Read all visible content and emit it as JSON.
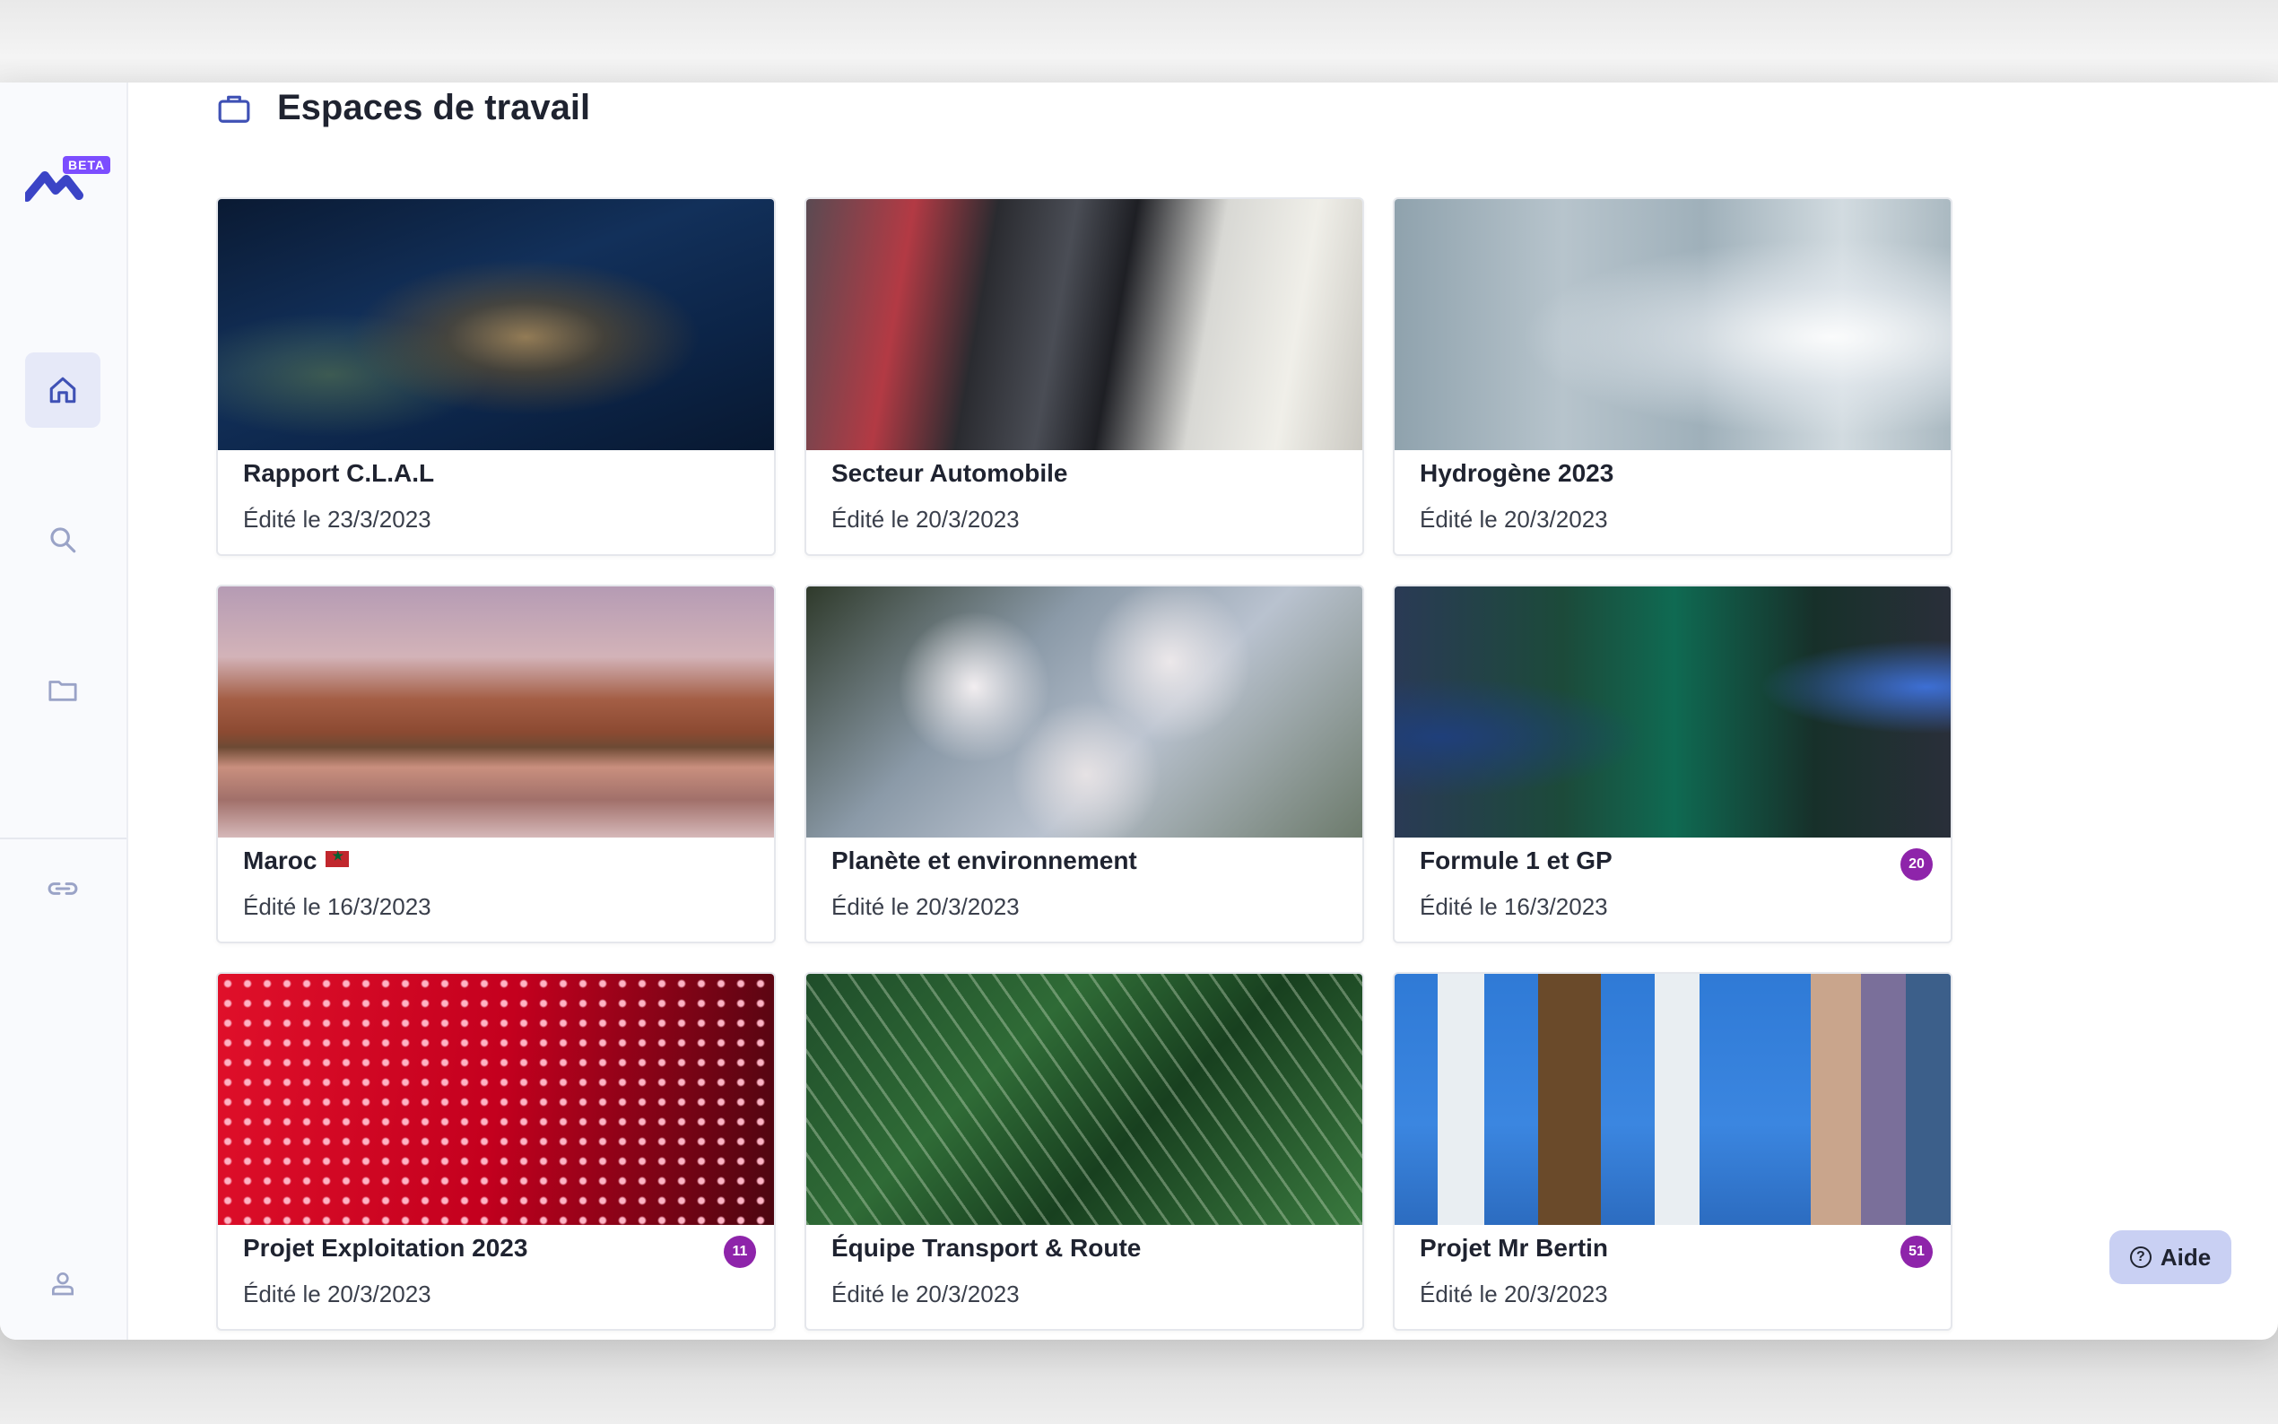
{
  "app": {
    "badge": "BETA",
    "page_title": "Espaces de travail"
  },
  "sidebar": {
    "items": [
      {
        "icon": "home-icon",
        "active": true
      },
      {
        "icon": "search-icon",
        "active": false
      },
      {
        "icon": "folder-icon",
        "active": false
      },
      {
        "icon": "link-icon",
        "active": false
      },
      {
        "icon": "user-icon",
        "active": false
      }
    ]
  },
  "workspaces": [
    {
      "title": "Rapport C.L.A.L",
      "date": "Édité le 23/3/2023",
      "badge": null
    },
    {
      "title": "Secteur Automobile",
      "date": "Édité le 20/3/2023",
      "badge": null
    },
    {
      "title": "Hydrogène 2023",
      "date": "Édité le 20/3/2023",
      "badge": null
    },
    {
      "title": "Maroc",
      "date": "Édité le 16/3/2023",
      "badge": null
    },
    {
      "title": "Planète et environnement",
      "date": "Édité le 20/3/2023",
      "badge": null
    },
    {
      "title": "Formule 1 et GP",
      "date": "Édité le 16/3/2023",
      "badge": "20"
    },
    {
      "title": "Projet Exploitation 2023",
      "date": "Édité le 20/3/2023",
      "badge": "11"
    },
    {
      "title": "Équipe Transport & Route",
      "date": "Édité le 20/3/2023",
      "badge": null
    },
    {
      "title": "Projet Mr Bertin",
      "date": "Édité le 20/3/2023",
      "badge": "51"
    }
  ],
  "help": {
    "label": "Aide"
  },
  "colors": {
    "accent": "#3f51b5",
    "badge": "#8e24aa",
    "help_bg": "#c9d0f3"
  }
}
